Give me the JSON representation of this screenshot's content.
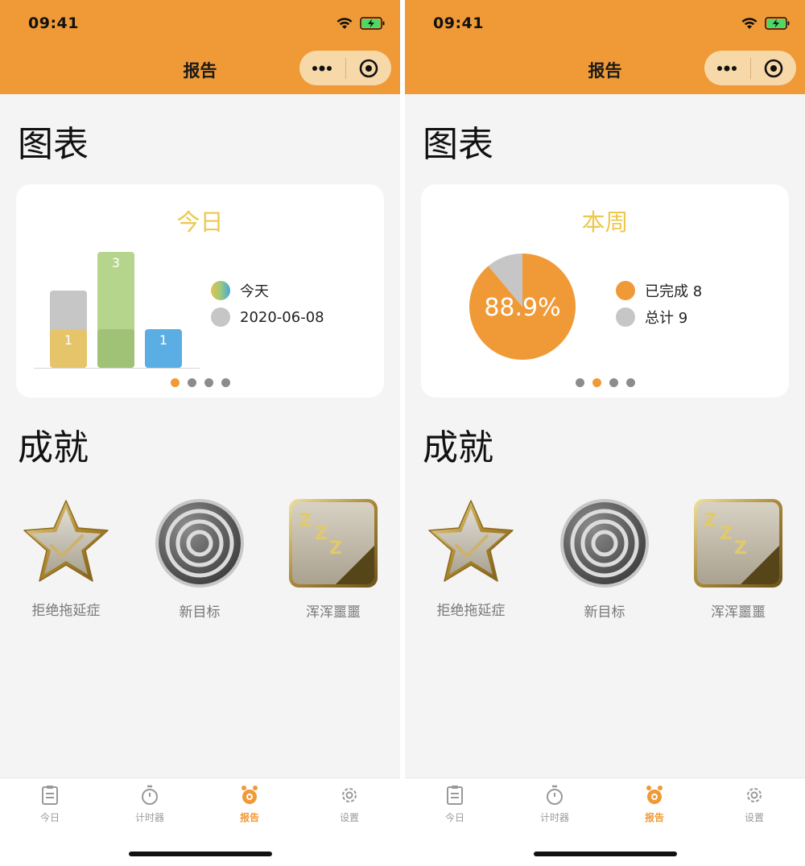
{
  "status": {
    "time": "09:41"
  },
  "nav": {
    "title": "报告"
  },
  "sections": {
    "chart_title": "图表",
    "achievements_title": "成就"
  },
  "left": {
    "card_title": "今日",
    "legend": [
      {
        "label": "今天",
        "color": "gradient"
      },
      {
        "label": "2020-06-08",
        "color": "#c6c6c6"
      }
    ],
    "pager_active": 0
  },
  "right": {
    "card_title": "本周",
    "legend": [
      {
        "label": "已完成 8",
        "color": "#f09a37"
      },
      {
        "label": "总计 9",
        "color": "#c6c6c6"
      }
    ],
    "pager_active": 1
  },
  "chart_data": [
    {
      "type": "bar",
      "categories": [
        "",
        "",
        ""
      ],
      "series": [
        {
          "name": "今天",
          "values": [
            1,
            3,
            1
          ]
        },
        {
          "name": "2020-06-08",
          "values": [
            2,
            3,
            1
          ]
        }
      ],
      "data_labels": [
        "1",
        "3",
        "1"
      ],
      "colors": [
        "#e6c46a",
        "#b5d58c",
        "#5baee3"
      ],
      "title": "今日"
    },
    {
      "type": "pie",
      "labels": [
        "已完成 8",
        "总计 9"
      ],
      "values": [
        8,
        1
      ],
      "center_label": "88.9%",
      "colors": [
        "#f09a37",
        "#c6c6c6"
      ],
      "title": "本周"
    }
  ],
  "achievements": [
    {
      "label": "拒绝拖延症",
      "icon": "star-badge-icon"
    },
    {
      "label": "新目标",
      "icon": "target-badge-icon"
    },
    {
      "label": "浑浑噩噩",
      "icon": "sleep-badge-icon"
    }
  ],
  "tabbar": [
    {
      "label": "今日",
      "icon": "clipboard-icon"
    },
    {
      "label": "计时器",
      "icon": "stopwatch-icon"
    },
    {
      "label": "报告",
      "icon": "alarm-clock-icon"
    },
    {
      "label": "设置",
      "icon": "gear-icon"
    }
  ],
  "active_tab": 2,
  "colors": {
    "accent": "#f09a37",
    "card_title": "#edc84f"
  }
}
